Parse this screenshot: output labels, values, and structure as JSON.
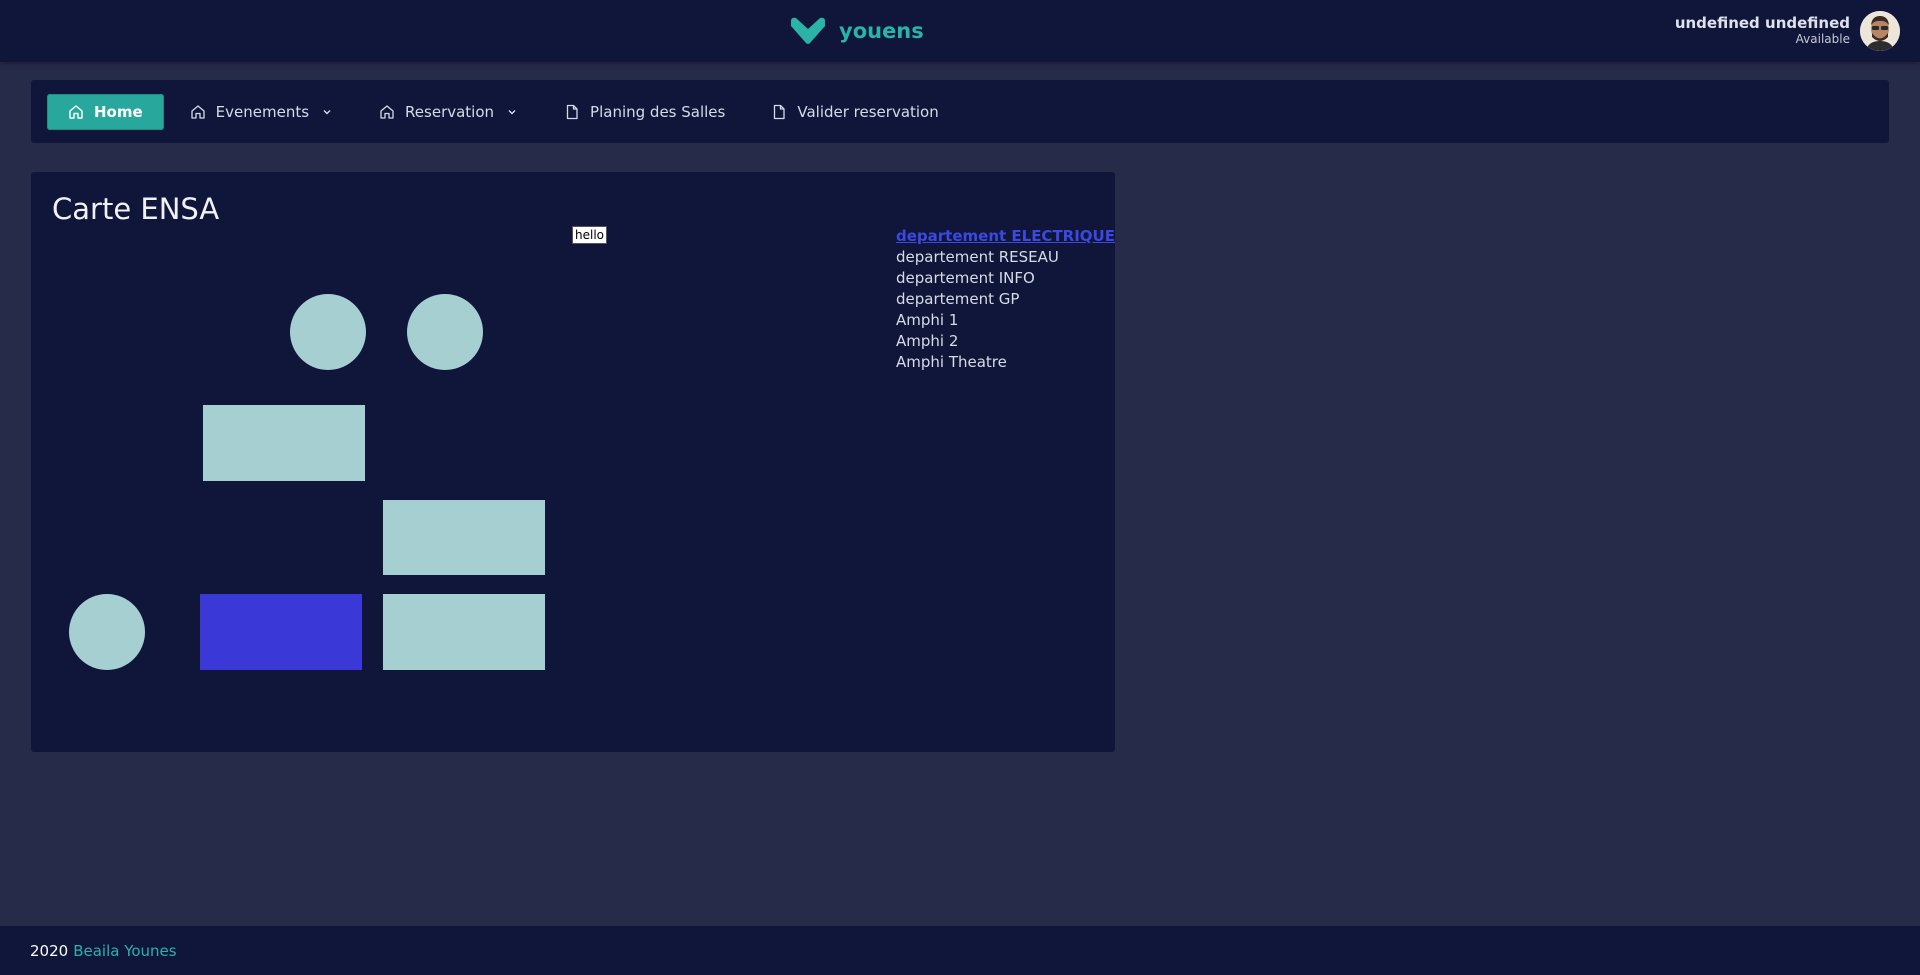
{
  "header": {
    "brand": "youens",
    "logo_icon": "v-logo-icon",
    "user_name": "undefined undefined",
    "user_status": "Available"
  },
  "nav": {
    "items": [
      {
        "label": "Home",
        "icon": "home-icon",
        "active": true
      },
      {
        "label": "Evenements",
        "icon": "home-icon",
        "dropdown": true
      },
      {
        "label": "Reservation",
        "icon": "home-icon",
        "dropdown": true
      },
      {
        "label": "Planing des Salles",
        "icon": "file-icon"
      },
      {
        "label": "Valider reservation",
        "icon": "file-icon"
      }
    ]
  },
  "map": {
    "title": "Carte ENSA",
    "tooltip": "hello",
    "departments": [
      "departement ELECTRIQUE",
      "departement RESEAU",
      "departement INFO",
      "departement GP",
      "Amphi 1",
      "Amphi 2",
      "Amphi Theatre"
    ],
    "selected_department": "departement ELECTRIQUE"
  },
  "footer": {
    "year": "2020",
    "author": "Beaila Younes"
  },
  "colors": {
    "background": "#272b4a",
    "panel": "#10163a",
    "accent": "#28a89c",
    "shape": "#a6cfd2",
    "selected_shape": "#3a38d6",
    "selected_link": "#3c48e0"
  }
}
